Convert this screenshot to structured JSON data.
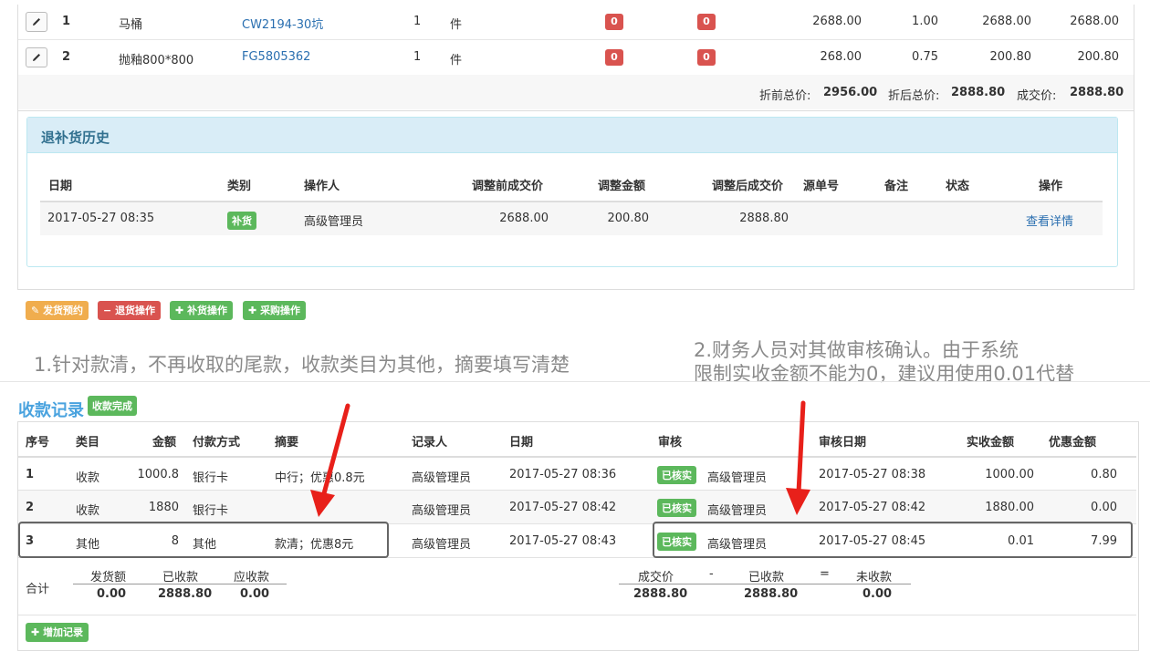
{
  "products": {
    "rows": [
      {
        "no": "1",
        "name": "马桶",
        "code": "CW2194-30坑",
        "qty": "1",
        "unit": "件",
        "badge1": "0",
        "badge2": "0",
        "price": "2688.00",
        "discount": "1.00",
        "discounted": "2688.00",
        "deal": "2688.00"
      },
      {
        "no": "2",
        "name": "抛釉800*800",
        "code": "FG5805362",
        "qty": "1",
        "unit": "件",
        "badge1": "0",
        "badge2": "0",
        "price": "268.00",
        "discount": "0.75",
        "discounted": "200.80",
        "deal": "200.80"
      }
    ],
    "totals": {
      "before_label": "折前总价:",
      "before": "2956.00",
      "after_label": "折后总价:",
      "after": "2888.80",
      "deal_label": "成交价:",
      "deal": "2888.80"
    }
  },
  "history": {
    "title": "退补货历史",
    "headers": [
      "日期",
      "类别",
      "操作人",
      "调整前成交价",
      "调整金额",
      "调整后成交价",
      "源单号",
      "备注",
      "状态",
      "操作"
    ],
    "row": {
      "date": "2017-05-27 08:35",
      "type": "补货",
      "operator": "高级管理员",
      "before": "2688.00",
      "amount": "200.80",
      "after": "2888.80",
      "action": "查看详情"
    }
  },
  "actions": [
    {
      "label": "发货预约",
      "icon": "pencil-icon",
      "color": "#f0ad4e"
    },
    {
      "label": "退货操作",
      "icon": "minus-icon",
      "color": "#d9534f"
    },
    {
      "label": "补货操作",
      "icon": "plus-icon",
      "color": "#5cb85c"
    },
    {
      "label": "采购操作",
      "icon": "plus-icon",
      "color": "#5cb85c"
    }
  ],
  "annotations": {
    "note1": "1.针对款清，不再收取的尾款，收款类目为其他，摘要填写清楚",
    "note2_line1": "2.财务人员对其做审核确认。由于系统",
    "note2_line2": "限制实收金额不能为0，建议用使用0.01代替"
  },
  "payments": {
    "title": "收款记录",
    "status": "收款完成",
    "headers": [
      "序号",
      "类目",
      "金额",
      "付款方式",
      "摘要",
      "记录人",
      "日期",
      "审核",
      "审核日期",
      "实收金额",
      "优惠金额"
    ],
    "rows": [
      {
        "no": "1",
        "category": "收款",
        "amount": "1000.8",
        "method": "银行卡",
        "summary": "中行；优惠0.8元",
        "recorder": "高级管理员",
        "date": "2017-05-27 08:36",
        "audit_badge": "已核实",
        "auditor": "高级管理员",
        "audit_date": "2017-05-27 08:38",
        "received": "1000.00",
        "discount": "0.80"
      },
      {
        "no": "2",
        "category": "收款",
        "amount": "1880",
        "method": "银行卡",
        "summary": "",
        "recorder": "高级管理员",
        "date": "2017-05-27 08:42",
        "audit_badge": "已核实",
        "auditor": "高级管理员",
        "audit_date": "2017-05-27 08:42",
        "received": "1880.00",
        "discount": "0.00"
      },
      {
        "no": "3",
        "category": "其他",
        "amount": "8",
        "method": "其他",
        "summary": "款清；优惠8元",
        "recorder": "高级管理员",
        "date": "2017-05-27 08:43",
        "audit_badge": "已核实",
        "auditor": "高级管理员",
        "audit_date": "2017-05-27 08:45",
        "received": "0.01",
        "discount": "7.99"
      }
    ],
    "summary": {
      "label": "合计",
      "shipped_label": "发货额",
      "shipped": "0.00",
      "received_label": "已收款",
      "received": "2888.80",
      "due_label": "应收款",
      "due": "0.00",
      "deal_label": "成交价",
      "deal": "2888.80",
      "minus": "-",
      "received2_label": "已收款",
      "received2": "2888.80",
      "equals": "=",
      "unreceived_label": "未收款",
      "unreceived": "0.00"
    },
    "add_button": "增加记录"
  },
  "colors": {
    "red": "#d9534f",
    "green": "#5cb85c",
    "orange": "#f0ad4e",
    "link": "#2a6fb0",
    "arrow": "#e8201a"
  }
}
